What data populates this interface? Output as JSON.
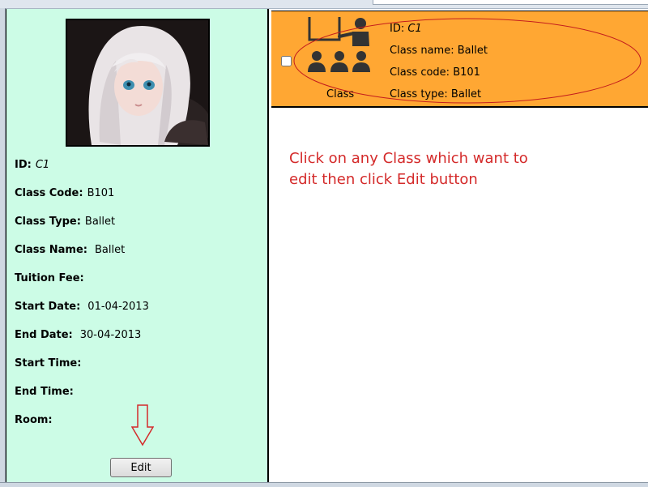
{
  "details": {
    "id_label": "ID:",
    "id_value": "C1",
    "code_label": "Class Code:",
    "code_value": "B101",
    "type_label": "Class Type:",
    "type_value": "Ballet",
    "name_label": "Class Name:",
    "name_value": "Ballet",
    "fee_label": "Tuition Fee:",
    "fee_value": "",
    "start_date_label": "Start Date:",
    "start_date_value": "01-04-2013",
    "end_date_label": "End Date:",
    "end_date_value": "30-04-2013",
    "start_time_label": "Start Time:",
    "start_time_value": "",
    "end_time_label": "End Time:",
    "end_time_value": "",
    "room_label": "Room:",
    "room_value": "",
    "edit_label": "Edit"
  },
  "card": {
    "caption": "Class",
    "id_label": "ID:",
    "id_value": "C1",
    "name_label": "Class name:",
    "name_value": "Ballet",
    "code_label": "Class code:",
    "code_value": "B101",
    "type_label": "Class type:",
    "type_value": "Ballet",
    "checked": false
  },
  "instruction": "Click on any Class which want to edit then click Edit button",
  "colors": {
    "left_panel_bg": "#ccfce6",
    "card_bg": "#ffa733",
    "instruction_text": "#d42a2a"
  }
}
